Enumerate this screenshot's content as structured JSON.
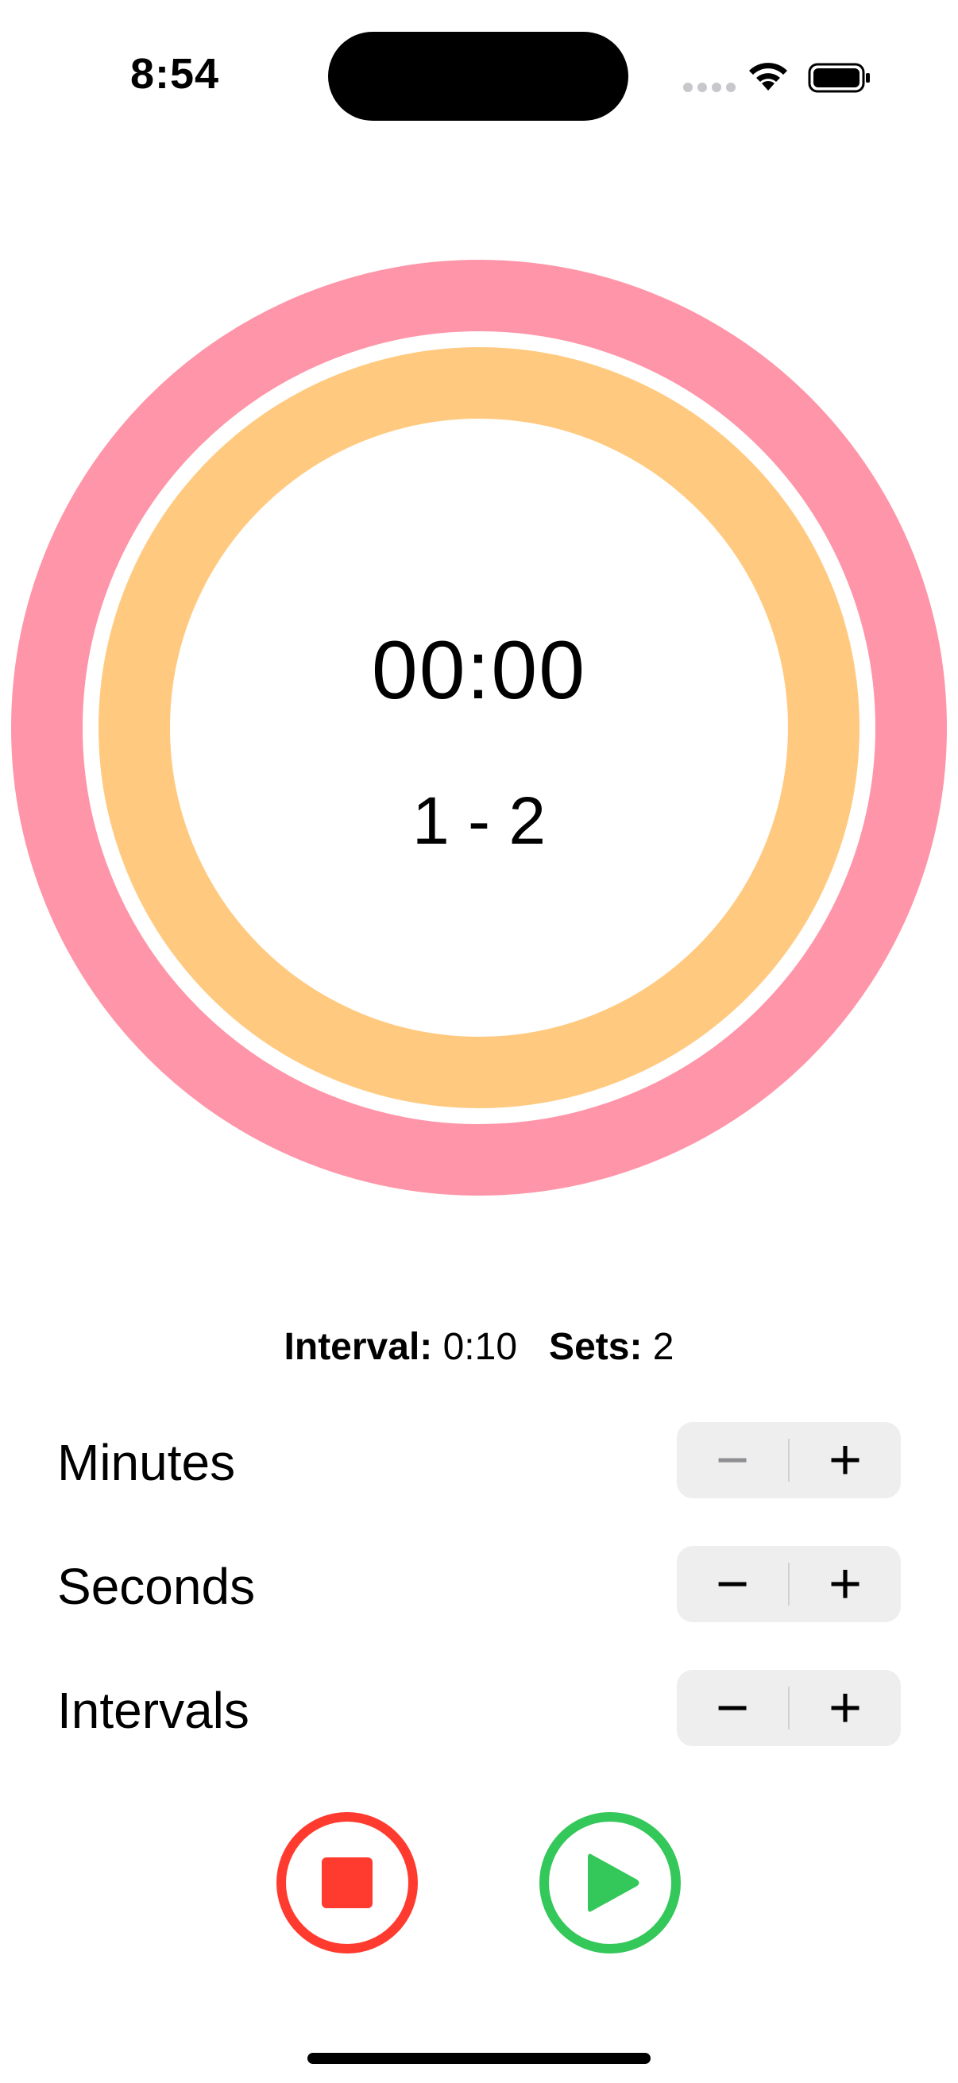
{
  "status_bar": {
    "time": "8:54"
  },
  "timer": {
    "time": "00:00",
    "set_progress": "1 - 2",
    "outer_ring_color": "#ff95a8",
    "inner_ring_color": "#ffca80"
  },
  "summary": {
    "interval_label": "Interval:",
    "interval_value": "0:10",
    "sets_label": "Sets:",
    "sets_value": "2"
  },
  "settings": [
    {
      "label": "Minutes",
      "minus": "−",
      "plus": "+",
      "minus_disabled": true
    },
    {
      "label": "Seconds",
      "minus": "−",
      "plus": "+",
      "minus_disabled": false
    },
    {
      "label": "Intervals",
      "minus": "−",
      "plus": "+",
      "minus_disabled": false
    }
  ],
  "controls": {
    "stop_icon": "stop-icon",
    "play_icon": "play-icon",
    "stop_color": "#ff3b30",
    "play_color": "#34c759"
  }
}
